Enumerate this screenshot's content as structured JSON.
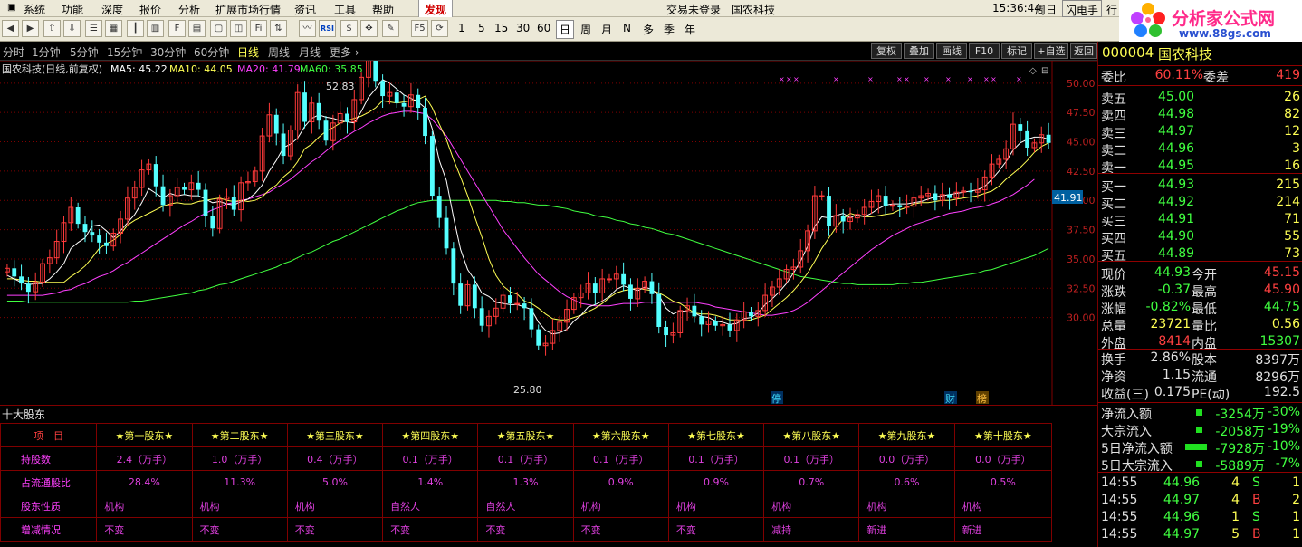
{
  "menu": {
    "items": [
      "系统",
      "功能",
      "深度",
      "报价",
      "分析",
      "扩展市场行情",
      "资讯",
      "工具",
      "帮助"
    ],
    "faxian": "发现",
    "trade_status": "交易未登录",
    "stock_name": "国农科技",
    "time": "15:36:44",
    "weekday": "周日",
    "flash": "闪电手",
    "more": "行"
  },
  "toolbar": {
    "nums": [
      "1",
      "5",
      "15",
      "30",
      "60"
    ],
    "periods": [
      "日",
      "周",
      "月",
      "N",
      "多",
      "季",
      "年"
    ]
  },
  "logo": {
    "title": "分析家公式网",
    "url": "www.88gs.com"
  },
  "period_bar": {
    "items": [
      "分时",
      "1分钟",
      "5分钟",
      "15分钟",
      "30分钟",
      "60分钟",
      "日线",
      "周线",
      "月线",
      "更多 ›"
    ],
    "active": "日线",
    "buttons": [
      "复权",
      "叠加",
      "画线",
      "F10",
      "标记",
      "+自选",
      "返回"
    ]
  },
  "chart_info": {
    "title": "国农科技(日线,前复权)",
    "ma5": "MA5: 45.22",
    "ma10": "MA10: 44.05",
    "ma20": "MA20: 41.79",
    "ma60": "MA60: 35.85",
    "max_label": "52.83",
    "min_label": "25.80",
    "current_price": "41.91",
    "markers": {
      "ting": "停",
      "cai": "财",
      "bang": "榜"
    }
  },
  "chart_data": {
    "type": "candlestick",
    "ylim": [
      27.5,
      53.0
    ],
    "yticks": [
      30.0,
      32.5,
      35.0,
      37.5,
      40.0,
      42.5,
      45.0,
      47.5,
      50.0
    ],
    "closes": [
      34.2,
      33.5,
      32.9,
      32.2,
      33.0,
      34.6,
      35.1,
      36.5,
      38.1,
      39.4,
      38.0,
      37.3,
      37.0,
      36.4,
      36.1,
      37.2,
      38.4,
      40.2,
      41.1,
      42.6,
      43.1,
      41.2,
      39.6,
      40.4,
      41.1,
      40.9,
      41.5,
      40.9,
      38.7,
      37.6,
      40.1,
      40.3,
      39.2,
      41.5,
      41.6,
      42.5,
      45.5,
      47.3,
      45.7,
      43.8,
      46.0,
      49.2,
      46.7,
      48.3,
      46.8,
      45.1,
      46.6,
      47.4,
      46.7,
      48.6,
      50.5,
      52.1,
      50.2,
      48.9,
      49.2,
      48.3,
      48.0,
      49.0,
      47.9,
      45.5,
      40.4,
      38.5,
      35.9,
      32.9,
      31.0,
      32.8,
      30.8,
      29.3,
      30.1,
      30.8,
      31.9,
      31.2,
      31.2,
      30.8,
      29.0,
      27.6,
      27.8,
      28.9,
      29.6,
      30.7,
      31.7,
      32.1,
      32.9,
      32.1,
      33.3,
      33.3,
      33.7,
      32.8,
      31.6,
      32.5,
      33.1,
      32.0,
      29.2,
      28.5,
      28.7,
      30.6,
      31.0,
      30.1,
      29.4,
      29.7,
      29.3,
      29.4,
      28.9,
      29.8,
      30.5,
      30.1,
      30.6,
      31.9,
      32.6,
      33.3,
      34.1,
      34.3,
      35.7,
      37.4,
      40.4,
      40.4,
      37.8,
      38.7,
      38.2,
      38.5,
      38.8,
      39.4,
      39.9,
      40.4,
      39.5,
      39.6,
      39.4,
      39.5,
      40.2,
      40.4,
      40.6,
      40.0,
      40.5,
      40.2,
      40.7,
      40.8,
      40.7,
      40.9,
      42.0,
      43.1,
      43.5,
      44.4,
      46.5,
      45.9,
      44.5,
      44.9,
      45.6,
      44.9
    ],
    "ma5": [
      33.6,
      33.3,
      33.0,
      32.8,
      32.9,
      32.9,
      33.3,
      33.9,
      34.6,
      35.9,
      36.4,
      36.8,
      37.8,
      37.9,
      37.4,
      36.8,
      37.4,
      38.1,
      38.8,
      39.8,
      41.0,
      40.6,
      40.2,
      40.6,
      40.4,
      40.5,
      40.4,
      40.4,
      40.1,
      39.8,
      39.9,
      39.7,
      39.6,
      39.9,
      40.1,
      40.6,
      41.3,
      42.5,
      43.4,
      44.5,
      44.8,
      45.3,
      46.3,
      47.0,
      47.3,
      47.1,
      47.0,
      46.8,
      46.7,
      46.6,
      47.6,
      48.8,
      49.5,
      50.3,
      50.0,
      49.5,
      49.0,
      48.7,
      48.4,
      47.9,
      46.1,
      43.4,
      41.7,
      38.6,
      35.8,
      34.1,
      33.2,
      32.1,
      31.8,
      31.3,
      31.2,
      31.1,
      31.1,
      30.9,
      30.7,
      29.6,
      28.9,
      28.6,
      28.7,
      29.0,
      29.7,
      30.2,
      30.9,
      31.1,
      31.4,
      31.8,
      32.4,
      32.7,
      32.5,
      32.3,
      32.6,
      32.4,
      31.9,
      30.8,
      30.3,
      30.6,
      30.5,
      30.4,
      30.1,
      30.0,
      29.7,
      29.6,
      29.4,
      29.5,
      29.9,
      30.0,
      30.4,
      31.1,
      31.6,
      32.2,
      32.9,
      33.8,
      34.8,
      36.1,
      37.8,
      38.6,
      38.5,
      38.7,
      38.9,
      38.5,
      38.8,
      38.6,
      38.9,
      39.3,
      39.6,
      39.7,
      39.7,
      39.7,
      39.8,
      39.9,
      40.1,
      40.3,
      40.4,
      40.5,
      40.6,
      40.7,
      40.8,
      40.9,
      41.2,
      41.8,
      42.5,
      43.3,
      44.3,
      44.9,
      45.2,
      45.4,
      45.4,
      45.2
    ],
    "ma10": [
      33.3,
      33.3,
      33.2,
      33.1,
      33.1,
      33.0,
      33.0,
      33.0,
      33.0,
      33.5,
      33.9,
      34.4,
      35.1,
      35.9,
      36.3,
      36.6,
      37.1,
      37.9,
      38.3,
      38.6,
      38.9,
      39.2,
      39.5,
      39.7,
      39.8,
      39.7,
      39.7,
      39.9,
      40.0,
      40.1,
      40.2,
      40.0,
      39.9,
      40.0,
      39.9,
      40.0,
      40.3,
      40.9,
      41.3,
      42.0,
      42.5,
      43.3,
      44.4,
      44.8,
      45.4,
      45.9,
      46.2,
      46.6,
      46.8,
      47.0,
      47.2,
      47.5,
      47.9,
      48.5,
      48.4,
      48.3,
      48.4,
      48.5,
      48.6,
      48.9,
      47.9,
      46.5,
      45.2,
      43.5,
      42.0,
      40.4,
      38.6,
      36.9,
      35.0,
      33.6,
      32.7,
      32.2,
      32.0,
      31.4,
      31.2,
      30.8,
      30.3,
      29.9,
      29.8,
      29.8,
      30.0,
      30.2,
      30.5,
      30.8,
      31.2,
      31.7,
      32.1,
      32.3,
      32.4,
      32.5,
      32.4,
      32.3,
      32.1,
      31.8,
      31.4,
      31.2,
      30.8,
      30.4,
      30.3,
      30.3,
      30.2,
      30.0,
      29.8,
      29.8,
      29.7,
      29.8,
      30.0,
      30.2,
      30.7,
      31.2,
      31.7,
      32.3,
      33.0,
      33.8,
      34.8,
      35.9,
      36.8,
      37.7,
      38.4,
      38.9,
      38.7,
      38.6,
      38.6,
      38.7,
      38.8,
      38.9,
      39.2,
      39.4,
      39.7,
      39.8,
      39.8,
      39.9,
      40.0,
      40.0,
      40.1,
      40.2,
      40.3,
      40.4,
      40.6,
      40.8,
      41.2,
      41.8,
      42.3,
      42.8,
      43.4,
      44.1,
      44.6,
      44.9
    ],
    "ma20": [
      31.9,
      31.9,
      31.9,
      31.9,
      31.9,
      31.9,
      32.0,
      32.1,
      32.3,
      32.4,
      32.7,
      32.9,
      33.2,
      33.5,
      33.7,
      34.0,
      34.4,
      34.7,
      35.1,
      35.5,
      35.9,
      36.3,
      36.7,
      37.1,
      37.5,
      37.9,
      38.2,
      38.6,
      38.9,
      39.2,
      39.4,
      39.7,
      39.8,
      40.0,
      40.1,
      40.3,
      40.5,
      40.7,
      41.1,
      41.4,
      41.8,
      42.3,
      42.8,
      43.3,
      43.7,
      44.2,
      44.7,
      45.1,
      45.5,
      45.9,
      46.2,
      46.6,
      46.9,
      47.2,
      47.4,
      47.5,
      47.6,
      47.6,
      47.5,
      47.4,
      46.9,
      46.2,
      45.5,
      44.5,
      43.5,
      42.5,
      41.5,
      40.5,
      39.5,
      38.5,
      37.5,
      36.7,
      35.9,
      35.1,
      34.4,
      33.7,
      33.2,
      32.7,
      32.2,
      31.8,
      31.5,
      31.2,
      31.1,
      31.0,
      31.0,
      31.0,
      31.1,
      31.2,
      31.2,
      31.2,
      31.3,
      31.3,
      31.3,
      31.3,
      31.3,
      31.3,
      31.3,
      31.3,
      31.2,
      31.1,
      30.9,
      30.8,
      30.7,
      30.6,
      30.5,
      30.4,
      30.3,
      30.2,
      30.2,
      30.3,
      30.4,
      30.6,
      30.9,
      31.3,
      31.8,
      32.3,
      32.8,
      33.3,
      33.8,
      34.3,
      34.8,
      35.3,
      35.8,
      36.2,
      36.6,
      37.0,
      37.3,
      37.6,
      37.9,
      38.1,
      38.3,
      38.5,
      38.7,
      38.9,
      39.0,
      39.1,
      39.3,
      39.4,
      39.5,
      39.7,
      39.9,
      40.2,
      40.5,
      40.9,
      41.3,
      41.8
    ],
    "ma60": [
      31.4,
      31.4,
      31.4,
      31.3,
      31.3,
      31.3,
      31.3,
      31.3,
      31.3,
      31.3,
      31.3,
      31.3,
      31.3,
      31.3,
      31.3,
      31.3,
      31.3,
      31.3,
      31.4,
      31.4,
      31.5,
      31.6,
      31.7,
      31.8,
      31.9,
      32.0,
      32.1,
      32.3,
      32.4,
      32.6,
      32.8,
      32.9,
      33.1,
      33.3,
      33.5,
      33.7,
      33.9,
      34.1,
      34.3,
      34.6,
      34.8,
      35.1,
      35.4,
      35.6,
      35.9,
      36.2,
      36.5,
      36.7,
      37.0,
      37.3,
      37.6,
      37.9,
      38.2,
      38.5,
      38.8,
      39.1,
      39.3,
      39.6,
      39.8,
      39.9,
      40.0,
      40.0,
      40.0,
      40.0,
      40.0,
      40.0,
      40.0,
      40.0,
      40.0,
      40.0,
      39.9,
      39.9,
      39.8,
      39.8,
      39.7,
      39.6,
      39.6,
      39.5,
      39.4,
      39.3,
      39.1,
      39.0,
      38.9,
      38.7,
      38.6,
      38.5,
      38.3,
      38.2,
      38.0,
      37.9,
      37.7,
      37.6,
      37.4,
      37.2,
      37.1,
      36.9,
      36.7,
      36.5,
      36.3,
      36.1,
      35.9,
      35.7,
      35.5,
      35.3,
      35.1,
      34.9,
      34.7,
      34.5,
      34.3,
      34.1,
      33.9,
      33.7,
      33.5,
      33.4,
      33.3,
      33.2,
      33.1,
      33.0,
      32.9,
      32.9,
      32.8,
      32.8,
      32.8,
      32.8,
      32.8,
      32.8,
      32.9,
      32.9,
      33.0,
      33.0,
      33.1,
      33.2,
      33.3,
      33.4,
      33.5,
      33.6,
      33.7,
      33.8,
      34.0,
      34.1,
      34.3,
      34.5,
      34.7,
      34.9,
      35.1,
      35.3,
      35.6,
      35.9
    ],
    "colors": {
      "up": "#ff3a3a",
      "down": "#54ffff",
      "ma5": "#ffffff",
      "ma10": "#ffff54",
      "ma20": "#ff40ff",
      "ma60": "#40ff40",
      "grid": "#800000"
    }
  },
  "shareholders": {
    "title": "十大股东",
    "headers": [
      "项　目",
      "★第一股东★",
      "★第二股东★",
      "★第三股东★",
      "★第四股东★",
      "★第五股东★",
      "★第六股东★",
      "★第七股东★",
      "★第八股东★",
      "★第九股东★",
      "★第十股东★"
    ],
    "rows": [
      {
        "label": "持股数",
        "values": [
          "2.4（万手）",
          "1.0（万手）",
          "0.4（万手）",
          "0.1（万手）",
          "0.1（万手）",
          "0.1（万手）",
          "0.1（万手）",
          "0.1（万手）",
          "0.0（万手）",
          "0.0（万手）"
        ]
      },
      {
        "label": "占流通股比",
        "values": [
          "28.4%",
          "11.3%",
          "5.0%",
          "1.4%",
          "1.3%",
          "0.9%",
          "0.9%",
          "0.7%",
          "0.6%",
          "0.5%"
        ]
      },
      {
        "label": "股东性质",
        "values": [
          "机构",
          "机构",
          "机构",
          "自然人",
          "自然人",
          "机构",
          "机构",
          "机构",
          "机构",
          "机构"
        ]
      },
      {
        "label": "增减情况",
        "values": [
          "不变",
          "不变",
          "不变",
          "不变",
          "不变",
          "不变",
          "不变",
          "减持",
          "新进",
          "新进"
        ]
      }
    ]
  },
  "right": {
    "code": "000004",
    "name": "国农科技",
    "weibi_label": "委比",
    "weibi": "60.11%",
    "weicha_label": "委差",
    "weicha": "419",
    "book": [
      {
        "label": "卖五",
        "price": "45.00",
        "vol": "26"
      },
      {
        "label": "卖四",
        "price": "44.98",
        "vol": "82"
      },
      {
        "label": "卖三",
        "price": "44.97",
        "vol": "12"
      },
      {
        "label": "卖二",
        "price": "44.96",
        "vol": "3"
      },
      {
        "label": "卖一",
        "price": "44.95",
        "vol": "16"
      },
      {
        "label": "买一",
        "price": "44.93",
        "vol": "215"
      },
      {
        "label": "买二",
        "price": "44.92",
        "vol": "214"
      },
      {
        "label": "买三",
        "price": "44.91",
        "vol": "71"
      },
      {
        "label": "买四",
        "price": "44.90",
        "vol": "55"
      },
      {
        "label": "买五",
        "price": "44.89",
        "vol": "73"
      }
    ],
    "quote": [
      {
        "l1": "现价",
        "v1": "44.93",
        "l2": "今开",
        "v2": "45.15"
      },
      {
        "l1": "涨跌",
        "v1": "-0.37",
        "l2": "最高",
        "v2": "45.90"
      },
      {
        "l1": "涨幅",
        "v1": "-0.82%",
        "l2": "最低",
        "v2": "44.75"
      },
      {
        "l1": "总量",
        "v1": "23721",
        "l2": "量比",
        "v2": "0.56"
      },
      {
        "l1": "外盘",
        "v1": "8414",
        "l2": "内盘",
        "v2": "15307"
      }
    ],
    "stats": [
      {
        "l1": "换手",
        "v1": "2.86%",
        "l2": "股本",
        "v2": "8397万"
      },
      {
        "l1": "净资",
        "v1": "1.15",
        "l2": "流通",
        "v2": "8296万"
      },
      {
        "l1": "收益(三)",
        "v1": "0.175",
        "l2": "PE(动)",
        "v2": "192.5"
      }
    ],
    "flows": [
      {
        "label": "净流入额",
        "value": "-3254万",
        "pct": "-30%"
      },
      {
        "label": "大宗流入",
        "value": "-2058万",
        "pct": "-19%"
      },
      {
        "label": "5日净流入额",
        "value": "-7928万",
        "pct": "-10%"
      },
      {
        "label": "5日大宗流入",
        "value": "-5889万",
        "pct": "-7%"
      }
    ],
    "ticks": [
      {
        "time": "14:55",
        "price": "44.96",
        "vol": "4",
        "side": "S",
        "n": "1"
      },
      {
        "time": "14:55",
        "price": "44.97",
        "vol": "4",
        "side": "B",
        "n": "2"
      },
      {
        "time": "14:55",
        "price": "44.96",
        "vol": "1",
        "side": "S",
        "n": "1"
      },
      {
        "time": "14:55",
        "price": "44.97",
        "vol": "5",
        "side": "B",
        "n": "1"
      }
    ]
  }
}
